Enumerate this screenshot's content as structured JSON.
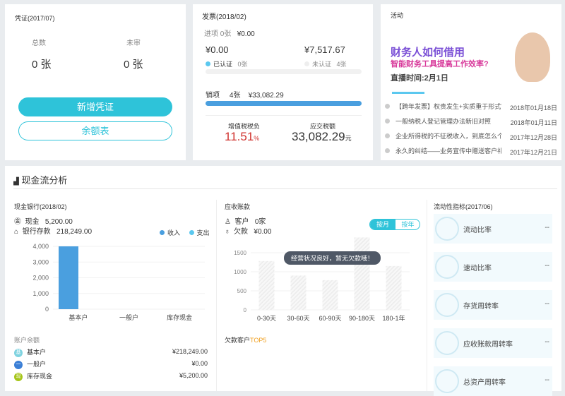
{
  "voucher": {
    "title": "凭证(2017/07)",
    "total_label": "总数",
    "total_value": "0 张",
    "unreviewed_label": "未审",
    "unreviewed_value": "0 张",
    "new_button": "新增凭证",
    "balance_button": "余额表"
  },
  "invoice": {
    "title": "发票(2018/02)",
    "input_label": "进项",
    "input_count": "0张",
    "input_amount": "¥0.00",
    "certified_amount": "¥0.00",
    "certified_label": "已认证",
    "certified_count": "0张",
    "uncertified_amount": "¥7,517.67",
    "uncertified_label": "未认证",
    "uncertified_count": "4张",
    "output_label": "销项",
    "output_count": "4张",
    "output_amount": "¥33,082.29",
    "vat_label": "增值税税负",
    "vat_value": "11.51",
    "vat_unit": "%",
    "tax_label": "应交税额",
    "tax_value": "33,082.29",
    "tax_unit": "元",
    "certified_fraction": 0,
    "output_fraction": 1
  },
  "activity": {
    "title": "活动",
    "banner_line1": "财务人如何借用",
    "banner_line2": "智能财务工具提高工作效率?",
    "banner_line3": "直播时间:2月1日",
    "news": [
      {
        "title": "【跨年发票】权责发生+实质重于形式VS合...",
        "date": "2018年01月18日"
      },
      {
        "title": "一般纳税人登记管理办法新旧对照",
        "date": "2018年01月11日"
      },
      {
        "title": "企业所得税的不征税收入，到底怎么个“不...",
        "date": "2017年12月28日"
      },
      {
        "title": "永久的纠结——业务宣传中赠送客户礼品个...",
        "date": "2017年12月21日"
      }
    ]
  },
  "cashflow": {
    "title": "现金流分析",
    "bank": {
      "title": "现金银行(2018/02)",
      "cash_label": "现金",
      "cash_value": "5,200.00",
      "deposit_label": "银行存款",
      "deposit_value": "218,249.00",
      "balance_title": "账户余额",
      "accounts": [
        {
          "icon": "基",
          "name": "基本户",
          "value": "¥218,249.00",
          "color": "#7fd3e0"
        },
        {
          "icon": "一",
          "name": "一般户",
          "value": "¥0.00",
          "color": "#3b7fd6"
        },
        {
          "icon": "现",
          "name": "库存现金",
          "value": "¥5,200.00",
          "color": "#a6c51a"
        }
      ]
    },
    "receivable": {
      "title": "应收账款",
      "customer_label": "客户",
      "customer_value": "0家",
      "debt_label": "欠款",
      "debt_value": "¥0.00",
      "toggle_month": "按月",
      "toggle_year": "按年",
      "tooltip": "经营状况良好，暂无欠款哦！",
      "top5_prefix": "欠款客户",
      "top5_suffix": "TOP5"
    },
    "liquidity": {
      "title": "流动性指标(2017/06)",
      "items": [
        {
          "label": "流动比率",
          "value": "--"
        },
        {
          "label": "速动比率",
          "value": "--"
        },
        {
          "label": "存货周转率",
          "value": "--"
        },
        {
          "label": "应收账款周转率",
          "value": "--"
        },
        {
          "label": "总资产周转率",
          "value": "--"
        }
      ]
    }
  },
  "colors": {
    "accent": "#2ec3d9",
    "income": "#4a9fdf",
    "expense": "#5bc8ef",
    "red": "#d0312d"
  },
  "chart_data": [
    {
      "type": "bar",
      "title": "",
      "categories": [
        "基本户",
        "一般户",
        "库存现金"
      ],
      "series": [
        {
          "name": "收入",
          "values": [
            4000,
            0,
            0
          ]
        },
        {
          "name": "支出",
          "values": [
            0,
            0,
            0
          ]
        }
      ],
      "yticks": [
        "0",
        "1,000",
        "2,000",
        "3,000",
        "4,000"
      ],
      "ylim": [
        0,
        4000
      ],
      "legend": "top-right"
    },
    {
      "type": "bar",
      "title": "",
      "categories": [
        "0-30天",
        "30-60天",
        "60-90天",
        "90-180天",
        "180-1年"
      ],
      "values": [
        1280,
        900,
        780,
        1900,
        1150
      ],
      "yticks": [
        "0",
        "500",
        "1000",
        "1500"
      ],
      "ylim": [
        0,
        1500
      ],
      "placeholder": true
    }
  ]
}
